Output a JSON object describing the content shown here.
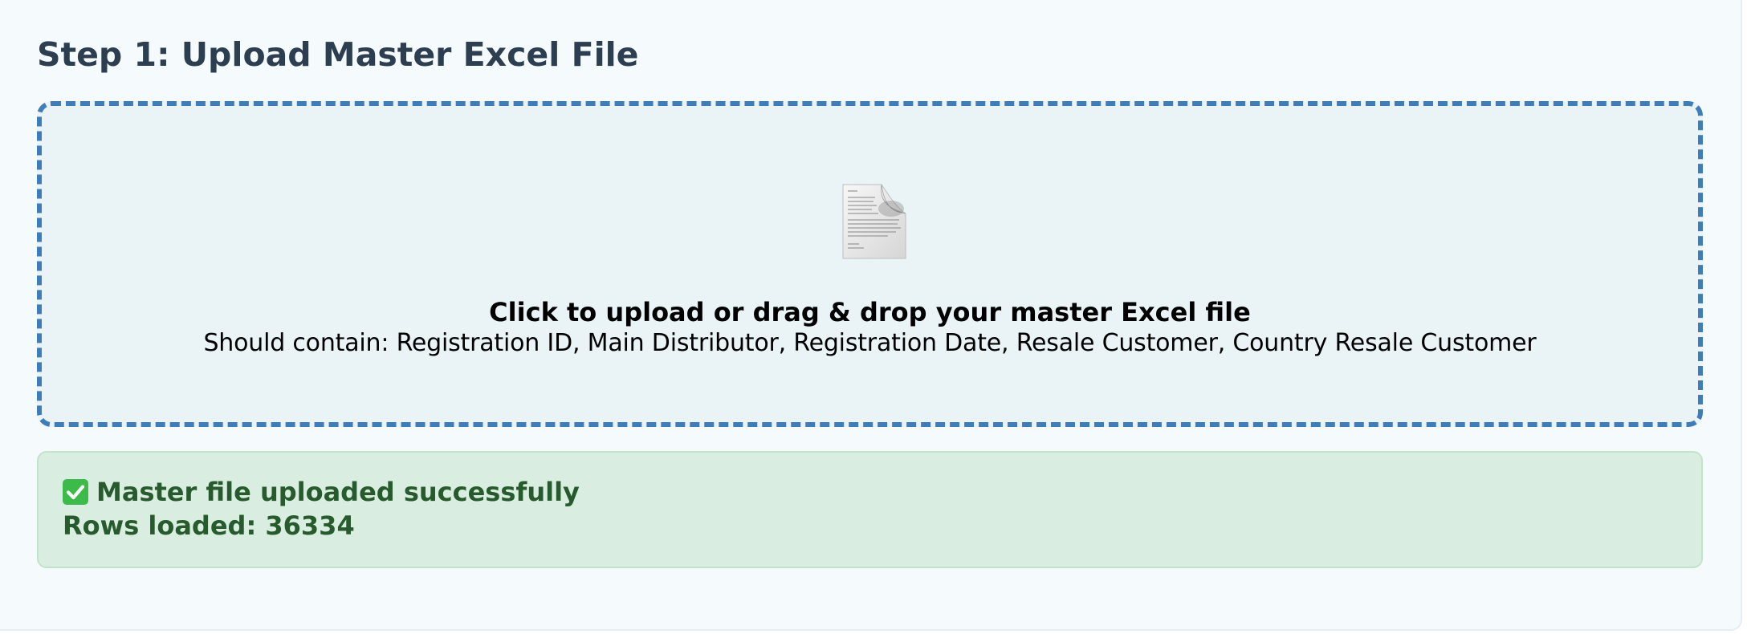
{
  "step": {
    "title": "Step 1: Upload Master Excel File"
  },
  "dropzone": {
    "icon": "document-icon",
    "main_text": "Click to upload or drag & drop your master Excel file",
    "sub_text": "Should contain: Registration ID, Main Distributor, Registration Date, Resale Customer, Country Resale Customer",
    "border_color": "#3f7db8"
  },
  "status": {
    "icon": "check-mark-icon",
    "message": "Master file uploaded successfully",
    "rows_label": "Rows loaded: ",
    "rows_value": "36334",
    "color": "#275a2c",
    "background": "#d9ede0"
  }
}
